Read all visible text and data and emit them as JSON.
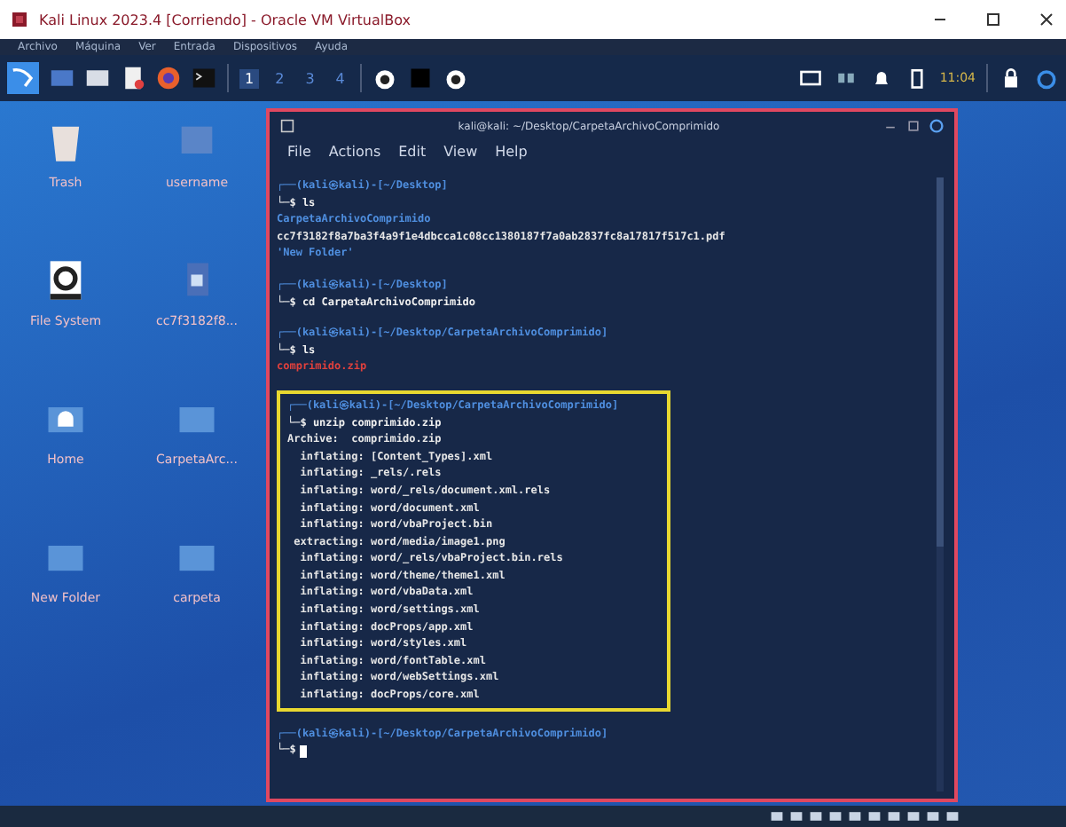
{
  "window": {
    "title": "Kali Linux 2023.4 [Corriendo] - Oracle VM VirtualBox"
  },
  "menu": [
    "Archivo",
    "Máquina",
    "Ver",
    "Entrada",
    "Dispositivos",
    "Ayuda"
  ],
  "panel": {
    "workspaces": [
      {
        "label": "1",
        "selected": true
      },
      {
        "label": "2",
        "selected": false
      },
      {
        "label": "3",
        "selected": false
      },
      {
        "label": "4",
        "selected": false
      }
    ],
    "clock": "11:04"
  },
  "desktop_icons": [
    {
      "label": "Trash",
      "kind": "trash"
    },
    {
      "label": "username",
      "kind": "file"
    },
    {
      "label": "File System",
      "kind": "drive"
    },
    {
      "label": "cc7f3182f8...",
      "kind": "document"
    },
    {
      "label": "Home",
      "kind": "home"
    },
    {
      "label": "CarpetaArc...",
      "kind": "folder"
    },
    {
      "label": "New Folder",
      "kind": "folder"
    },
    {
      "label": "carpeta",
      "kind": "folder"
    }
  ],
  "terminal": {
    "title": "kali@kali: ~/Desktop/CarpetaArchivoComprimido",
    "menu": [
      "File",
      "Actions",
      "Edit",
      "View",
      "Help"
    ],
    "blocks": [
      {
        "highlighted": false,
        "prompt": "┌──(kali㉿kali)-[~/Desktop]",
        "command": "└─$ ls",
        "output": [
          {
            "text": "CarpetaArchivoComprimido",
            "color": "#4f8fe0"
          },
          {
            "text": "cc7f3182f8a7ba3f4a9f1e4dbcca1c08cc1380187f7a0ab2837fc8a17817f517c1.pdf",
            "color": "#e6e6e6"
          },
          {
            "text": "'New Folder'",
            "color": "#4f8fe0"
          }
        ]
      },
      {
        "highlighted": false,
        "prompt": "┌──(kali㉿kali)-[~/Desktop]",
        "command": "└─$ cd CarpetaArchivoComprimido"
      },
      {
        "highlighted": false,
        "prompt": "┌──(kali㉿kali)-[~/Desktop/CarpetaArchivoComprimido]",
        "command": "└─$ ls",
        "output": [
          {
            "text": "comprimido.zip",
            "color": "#e0403c"
          }
        ]
      },
      {
        "highlighted": true,
        "prompt": "┌──(kali㉿kali)-[~/Desktop/CarpetaArchivoComprimido]",
        "command": "└─$ unzip comprimido.zip",
        "output": [
          {
            "text": "Archive:  comprimido.zip",
            "color": "#e6e6e6"
          },
          {
            "text": "  inflating: [Content_Types].xml",
            "color": "#e6e6e6"
          },
          {
            "text": "  inflating: _rels/.rels",
            "color": "#e6e6e6"
          },
          {
            "text": "  inflating: word/_rels/document.xml.rels",
            "color": "#e6e6e6"
          },
          {
            "text": "  inflating: word/document.xml",
            "color": "#e6e6e6"
          },
          {
            "text": "  inflating: word/vbaProject.bin",
            "color": "#e6e6e6"
          },
          {
            "text": " extracting: word/media/image1.png",
            "color": "#e6e6e6"
          },
          {
            "text": "  inflating: word/_rels/vbaProject.bin.rels",
            "color": "#e6e6e6"
          },
          {
            "text": "  inflating: word/theme/theme1.xml",
            "color": "#e6e6e6"
          },
          {
            "text": "  inflating: word/vbaData.xml",
            "color": "#e6e6e6"
          },
          {
            "text": "  inflating: word/settings.xml",
            "color": "#e6e6e6"
          },
          {
            "text": "  inflating: docProps/app.xml",
            "color": "#e6e6e6"
          },
          {
            "text": "  inflating: word/styles.xml",
            "color": "#e6e6e6"
          },
          {
            "text": "  inflating: word/fontTable.xml",
            "color": "#e6e6e6"
          },
          {
            "text": "  inflating: word/webSettings.xml",
            "color": "#e6e6e6"
          },
          {
            "text": "  inflating: docProps/core.xml",
            "color": "#e6e6e6"
          }
        ]
      },
      {
        "highlighted": false,
        "prompt": "┌──(kali㉿kali)-[~/Desktop/CarpetaArchivoComprimido]",
        "command": "└─$"
      }
    ]
  }
}
